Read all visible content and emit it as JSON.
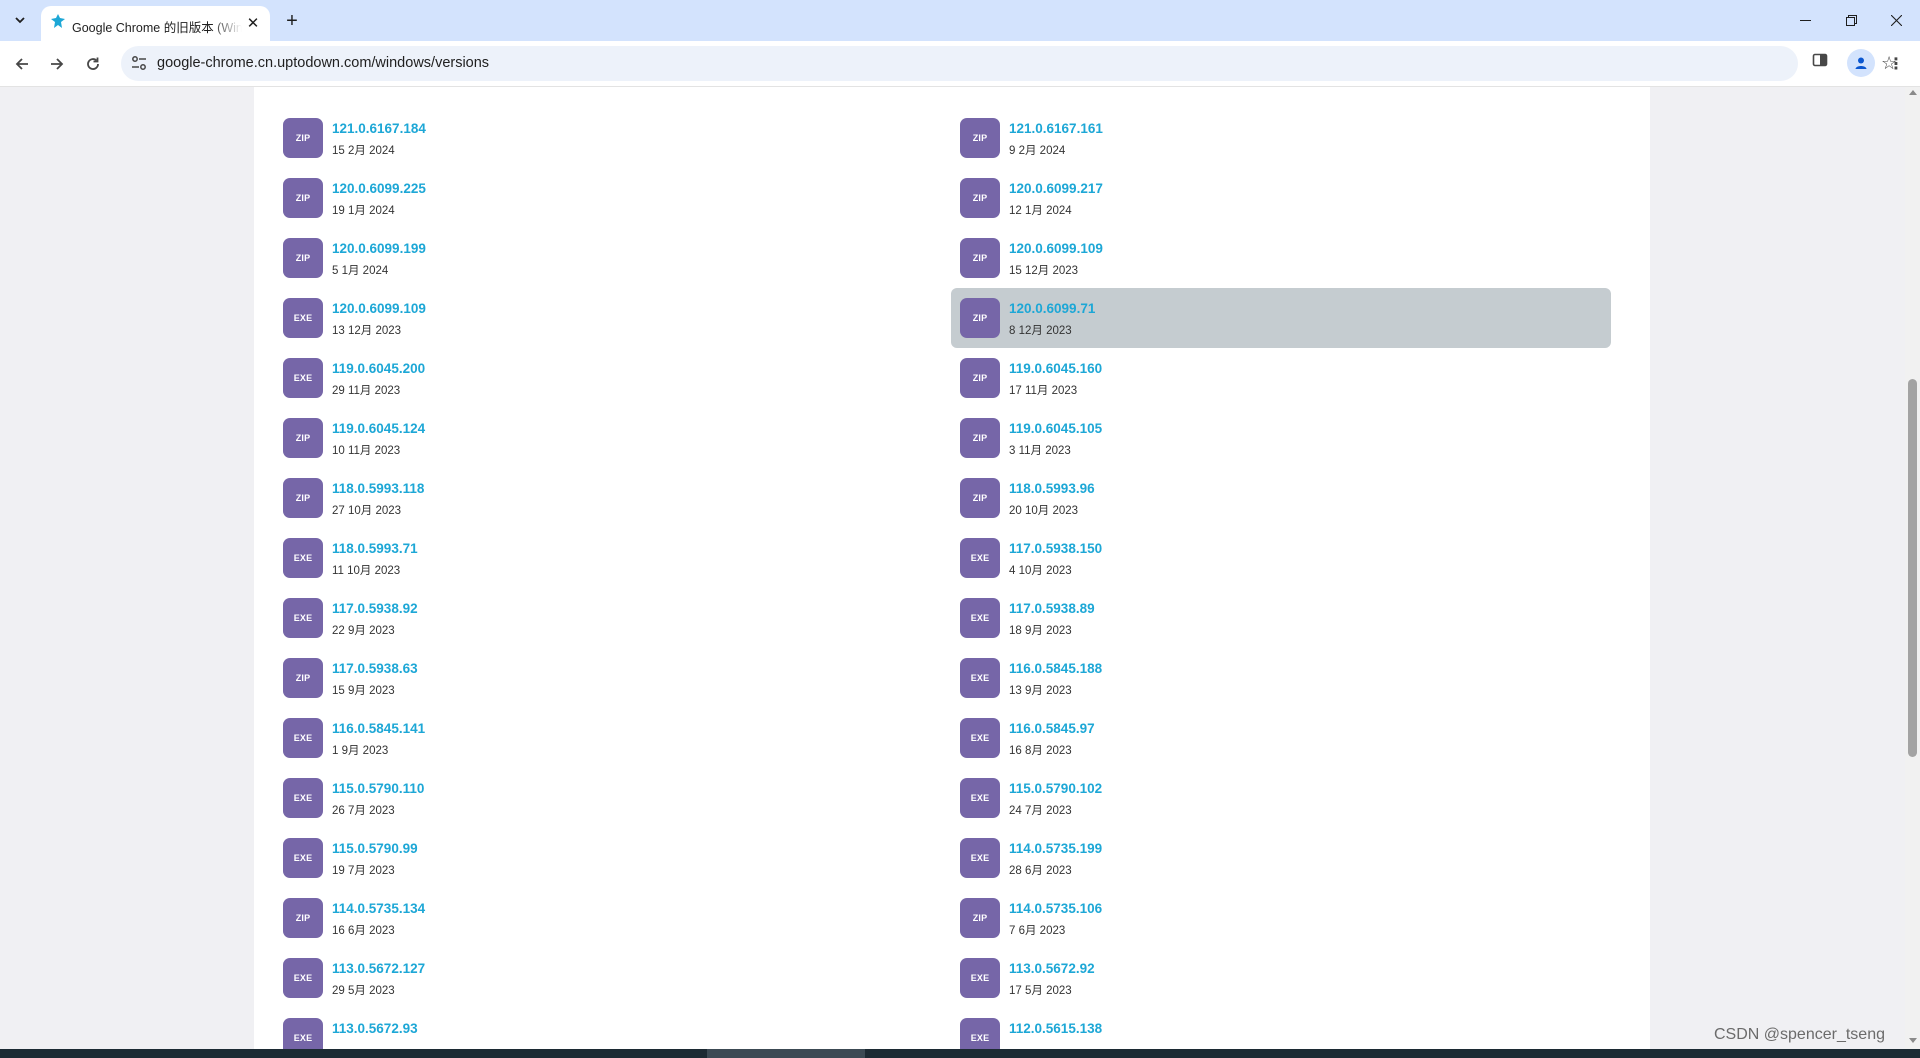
{
  "browser": {
    "tab": {
      "title": "Google Chrome 的旧版本 (Windows)"
    },
    "address_bar": {
      "url": "google-chrome.cn.uptodown.com/windows/versions"
    }
  },
  "colors": {
    "version_link": "#1da7d6",
    "file_icon_bg": "#7666a8",
    "hover_row_bg": "#c5ccd0",
    "tabstrip_bg": "#d3e3fd"
  },
  "icons": {
    "tab_search": "chevron-down-icon",
    "favicon": "uptodown-logo-icon",
    "back": "arrow-left-icon",
    "forward": "arrow-right-icon",
    "reload": "reload-icon",
    "site_info": "tune-icon",
    "bookmark": "star-icon",
    "side_panel": "side-panel-icon",
    "profile": "person-icon",
    "menu": "more-vertical-icon"
  },
  "versions": {
    "left": [
      {
        "type": "ZIP",
        "version": "121.0.6167.184",
        "date": "15 2月 2024"
      },
      {
        "type": "ZIP",
        "version": "120.0.6099.225",
        "date": "19 1月 2024"
      },
      {
        "type": "ZIP",
        "version": "120.0.6099.199",
        "date": "5 1月 2024"
      },
      {
        "type": "EXE",
        "version": "120.0.6099.109",
        "date": "13 12月 2023"
      },
      {
        "type": "EXE",
        "version": "119.0.6045.200",
        "date": "29 11月 2023"
      },
      {
        "type": "ZIP",
        "version": "119.0.6045.124",
        "date": "10 11月 2023"
      },
      {
        "type": "ZIP",
        "version": "118.0.5993.118",
        "date": "27 10月 2023"
      },
      {
        "type": "EXE",
        "version": "118.0.5993.71",
        "date": "11 10月 2023"
      },
      {
        "type": "EXE",
        "version": "117.0.5938.92",
        "date": "22 9月 2023"
      },
      {
        "type": "ZIP",
        "version": "117.0.5938.63",
        "date": "15 9月 2023"
      },
      {
        "type": "EXE",
        "version": "116.0.5845.141",
        "date": "1 9月 2023"
      },
      {
        "type": "EXE",
        "version": "115.0.5790.110",
        "date": "26 7月 2023"
      },
      {
        "type": "EXE",
        "version": "115.0.5790.99",
        "date": "19 7月 2023"
      },
      {
        "type": "ZIP",
        "version": "114.0.5735.134",
        "date": "16 6月 2023"
      },
      {
        "type": "EXE",
        "version": "113.0.5672.127",
        "date": "29 5月 2023"
      },
      {
        "type": "EXE",
        "version": "113.0.5672.93",
        "date": ""
      }
    ],
    "right": [
      {
        "type": "ZIP",
        "version": "121.0.6167.161",
        "date": "9 2月 2024"
      },
      {
        "type": "ZIP",
        "version": "120.0.6099.217",
        "date": "12 1月 2024"
      },
      {
        "type": "ZIP",
        "version": "120.0.6099.109",
        "date": "15 12月 2023"
      },
      {
        "type": "ZIP",
        "version": "120.0.6099.71",
        "date": "8 12月 2023",
        "hovered": true
      },
      {
        "type": "ZIP",
        "version": "119.0.6045.160",
        "date": "17 11月 2023"
      },
      {
        "type": "ZIP",
        "version": "119.0.6045.105",
        "date": "3 11月 2023"
      },
      {
        "type": "ZIP",
        "version": "118.0.5993.96",
        "date": "20 10月 2023"
      },
      {
        "type": "EXE",
        "version": "117.0.5938.150",
        "date": "4 10月 2023"
      },
      {
        "type": "EXE",
        "version": "117.0.5938.89",
        "date": "18 9月 2023"
      },
      {
        "type": "EXE",
        "version": "116.0.5845.188",
        "date": "13 9月 2023"
      },
      {
        "type": "EXE",
        "version": "116.0.5845.97",
        "date": "16 8月 2023"
      },
      {
        "type": "EXE",
        "version": "115.0.5790.102",
        "date": "24 7月 2023"
      },
      {
        "type": "EXE",
        "version": "114.0.5735.199",
        "date": "28 6月 2023"
      },
      {
        "type": "ZIP",
        "version": "114.0.5735.106",
        "date": "7 6月 2023"
      },
      {
        "type": "EXE",
        "version": "113.0.5672.92",
        "date": "17 5月 2023"
      },
      {
        "type": "EXE",
        "version": "112.0.5615.138",
        "date": ""
      }
    ]
  },
  "watermark": "CSDN @spencer_tseng"
}
